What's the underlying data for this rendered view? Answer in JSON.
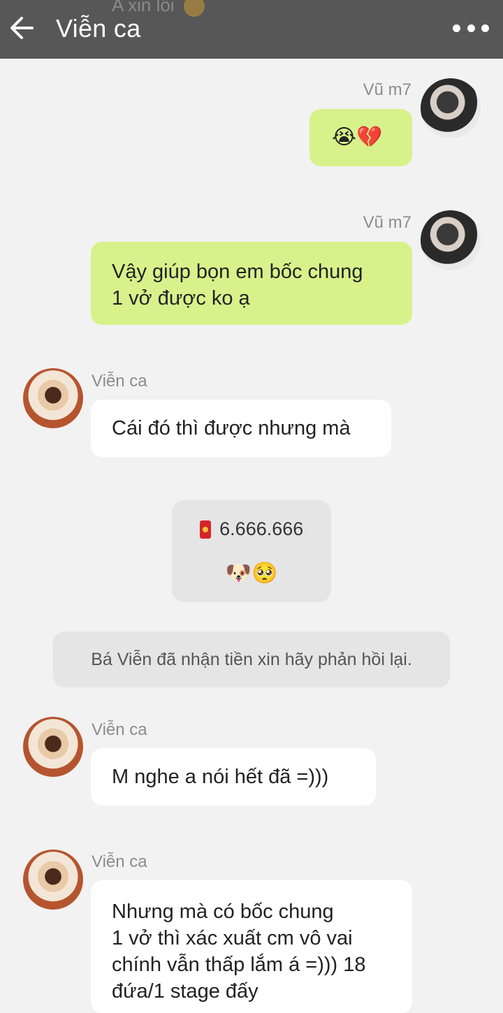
{
  "header": {
    "title": "Viễn ca",
    "previous_message_text": "A xin lỗi",
    "previous_message_emoji": "🙁"
  },
  "messages": [
    {
      "sender": "Vũ m7",
      "direction": "outgoing",
      "text": "😭💔"
    },
    {
      "sender": "Vũ m7",
      "direction": "outgoing",
      "lines": [
        "Vậy giúp bọn em bốc chung",
        "1 vở được ko ạ"
      ]
    },
    {
      "sender": "Viễn ca",
      "direction": "incoming",
      "text": "Cái đó thì được nhưng mà"
    },
    {
      "type": "red_envelope",
      "amount": "6.666.666",
      "emoji": "🐶🥺"
    },
    {
      "type": "system",
      "text": "Bá Viễn đã nhận tiền xin hãy phản hồi lại."
    },
    {
      "sender": "Viễn ca",
      "direction": "incoming",
      "text": "M nghe a nói hết đã =)))"
    },
    {
      "sender": "Viễn ca",
      "direction": "incoming",
      "lines": [
        "Nhưng mà có bốc chung",
        "1 vở thì xác xuất cm vô vai",
        "chính vẫn thấp lắm á =))) 18",
        "đứa/1 stage đấy"
      ]
    }
  ],
  "icons": {
    "back": "back-arrow-icon",
    "more": "more-options-icon",
    "envelope": "red-envelope-icon"
  },
  "colors": {
    "header_bg": "#575757",
    "outgoing_bubble": "#d7f28b",
    "incoming_bubble": "#ffffff",
    "chat_bg": "#f2f2f2"
  }
}
